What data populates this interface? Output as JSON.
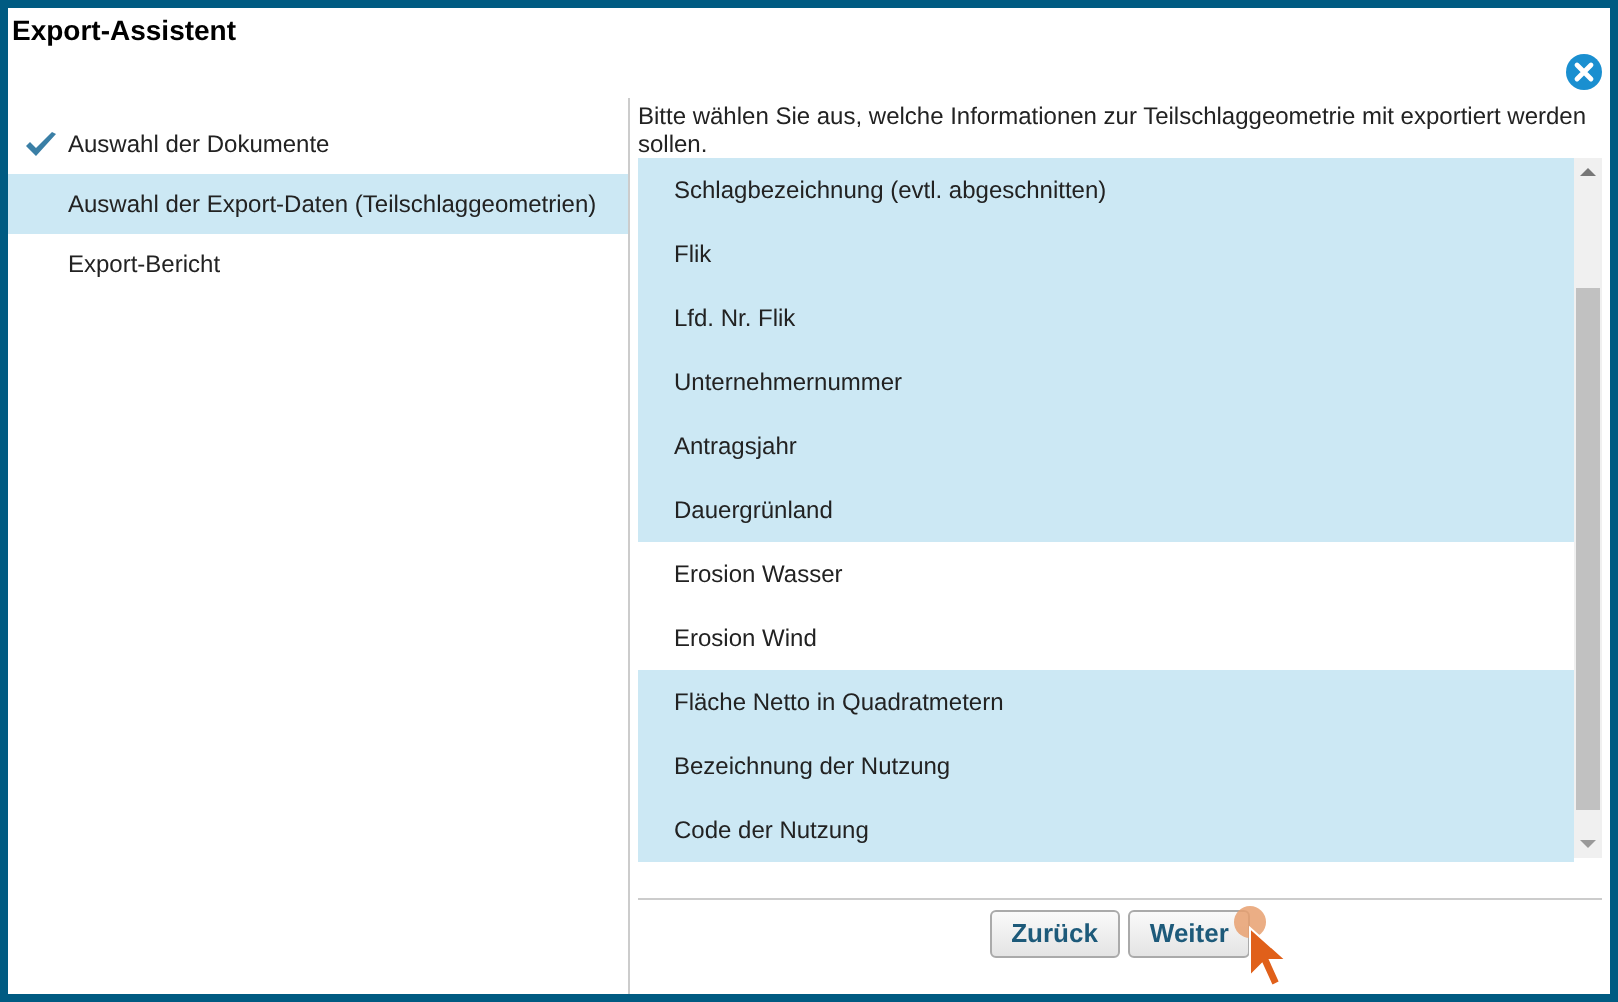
{
  "window": {
    "title": "Export-Assistent"
  },
  "steps": [
    {
      "label": "Auswahl der Dokumente",
      "done": true,
      "selected": false
    },
    {
      "label": "Auswahl der Export-Daten (Teilschlaggeometrien)",
      "done": false,
      "selected": true
    },
    {
      "label": "Export-Bericht",
      "done": false,
      "selected": false
    }
  ],
  "instruction": "Bitte wählen Sie aus, welche Informationen zur Teilschlaggeometrie mit exportiert werden sollen.",
  "fields": [
    {
      "label": "Schlagbezeichnung (evtl. abgeschnitten)",
      "selected": true
    },
    {
      "label": "Flik",
      "selected": true
    },
    {
      "label": "Lfd. Nr. Flik",
      "selected": true
    },
    {
      "label": "Unternehmernummer",
      "selected": true
    },
    {
      "label": "Antragsjahr",
      "selected": true
    },
    {
      "label": "Dauergrünland",
      "selected": true
    },
    {
      "label": "Erosion Wasser",
      "selected": false
    },
    {
      "label": "Erosion Wind",
      "selected": false
    },
    {
      "label": "Fläche Netto in Quadratmetern",
      "selected": true
    },
    {
      "label": "Bezeichnung der Nutzung",
      "selected": true
    },
    {
      "label": "Code der Nutzung",
      "selected": true
    }
  ],
  "buttons": [
    "Zurück",
    "Weiter"
  ]
}
